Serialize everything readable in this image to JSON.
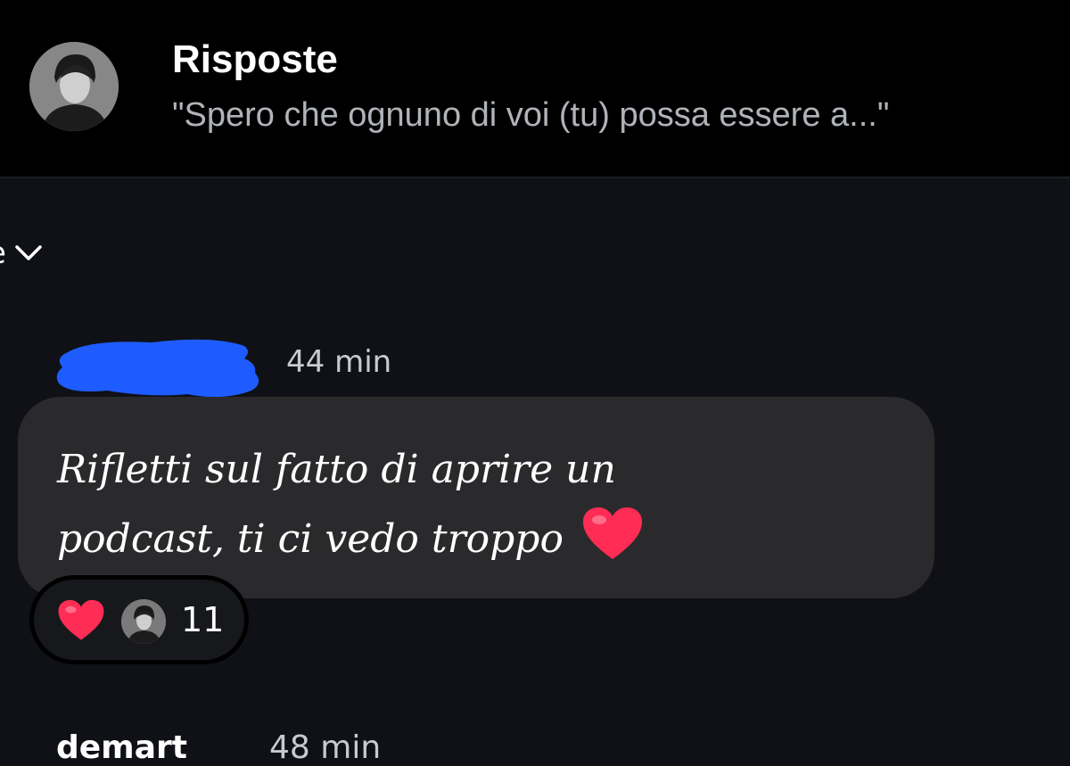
{
  "header": {
    "title": "Risposte",
    "subtitle": "\"Spero che ognuno di voi (tu) possa essere a...\"",
    "avatar_icon": "profile-photo"
  },
  "filter": {
    "label": "e",
    "icon": "chevron-down-icon"
  },
  "comment": {
    "timestamp": "44 min",
    "text_line1": "Rifletti sul fatto di aprire un",
    "text_line2": "podcast, ti ci vedo troppo",
    "emoji": "red-heart",
    "reactions": {
      "emoji": "red-heart",
      "count": "11"
    }
  },
  "next_comment": {
    "username": "demart",
    "timestamp": "48 min"
  },
  "colors": {
    "background": "#0f1116",
    "header_background": "#000000",
    "bubble": "#2a2a2d",
    "redaction_blue": "#1f5cff",
    "heart": "#ff2d55"
  }
}
